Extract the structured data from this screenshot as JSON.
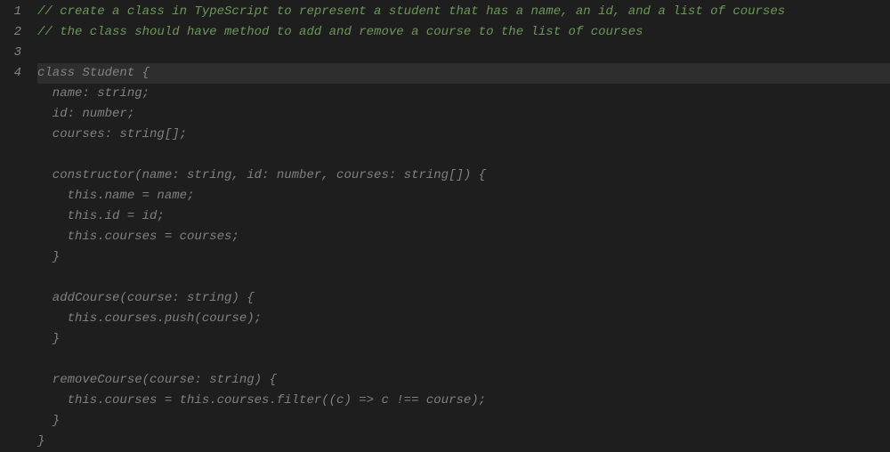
{
  "lineNumbers": [
    "1",
    "2",
    "3",
    "4"
  ],
  "currentLineIndex": 3,
  "codeLines": [
    {
      "text": "// create a class in TypeScript to represent a student that has a name, an id, and a list of courses",
      "cls": "comment"
    },
    {
      "text": "// the class should have method to add and remove a course to the list of courses",
      "cls": "comment"
    },
    {
      "text": "",
      "cls": ""
    },
    {
      "text": "class Student {",
      "cls": ""
    },
    {
      "text": "  name: string;",
      "cls": ""
    },
    {
      "text": "  id: number;",
      "cls": ""
    },
    {
      "text": "  courses: string[];",
      "cls": ""
    },
    {
      "text": "",
      "cls": ""
    },
    {
      "text": "  constructor(name: string, id: number, courses: string[]) {",
      "cls": ""
    },
    {
      "text": "    this.name = name;",
      "cls": ""
    },
    {
      "text": "    this.id = id;",
      "cls": ""
    },
    {
      "text": "    this.courses = courses;",
      "cls": ""
    },
    {
      "text": "  }",
      "cls": ""
    },
    {
      "text": "",
      "cls": ""
    },
    {
      "text": "  addCourse(course: string) {",
      "cls": ""
    },
    {
      "text": "    this.courses.push(course);",
      "cls": ""
    },
    {
      "text": "  }",
      "cls": ""
    },
    {
      "text": "",
      "cls": ""
    },
    {
      "text": "  removeCourse(course: string) {",
      "cls": ""
    },
    {
      "text": "    this.courses = this.courses.filter((c) => c !== course);",
      "cls": ""
    },
    {
      "text": "  }",
      "cls": ""
    },
    {
      "text": "}",
      "cls": ""
    }
  ]
}
